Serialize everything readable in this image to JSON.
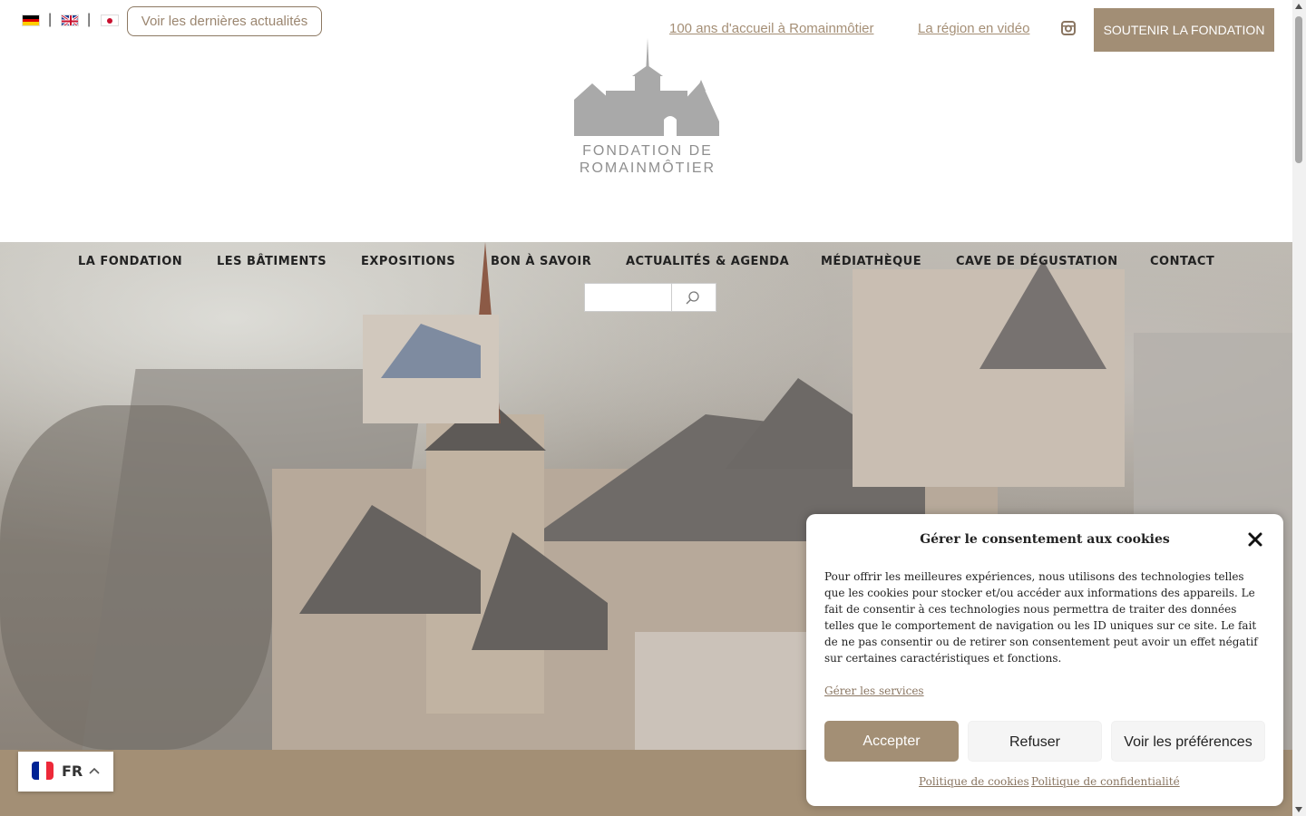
{
  "languages": [
    "Deutsch",
    "English",
    "日本語"
  ],
  "header": {
    "news_button": "Voir les dernières actualités",
    "links": [
      "100 ans d'accueil à Romainmôtier",
      "La région en vidéo"
    ],
    "support_button": "SOUTENIR LA FONDATION",
    "social_icon": "instagram-icon"
  },
  "logo": {
    "line1": "FONDATION DE",
    "line2": "ROMAINMÔTIER"
  },
  "nav": {
    "items": [
      "LA FONDATION",
      "LES BÂTIMENTS",
      "EXPOSITIONS",
      "BON À SAVOIR",
      "ACTUALITÉS & AGENDA",
      "MÉDIATHÈQUE",
      "CAVE DE DÉGUSTATION",
      "CONTACT"
    ]
  },
  "search": {
    "value": "",
    "icon": "search-icon"
  },
  "language_switcher": {
    "code": "FR",
    "icon": "chevron-up-icon"
  },
  "cookie_banner": {
    "title": "Gérer le consentement aux cookies",
    "text": "Pour offrir les meilleures expériences, nous utilisons des technologies telles que les cookies pour stocker et/ou accéder aux informations des appareils. Le fait de consentir à ces technologies nous permettra de traiter des données telles que le comportement de navigation ou les ID uniques sur ce site. Le fait de ne pas consentir ou de retirer son consentement peut avoir un effet négatif sur certaines caractéristiques et fonctions.",
    "manage_services": "Gérer les services",
    "accept": "Accepter",
    "refuse": "Refuser",
    "preferences": "Voir les préférences",
    "cookie_policy": "Politique de cookies",
    "privacy_policy": "Politique de confidentialité"
  },
  "colors": {
    "accent": "#a38f75",
    "link": "#a58f76",
    "logo_gray": "#a8a8a8"
  }
}
